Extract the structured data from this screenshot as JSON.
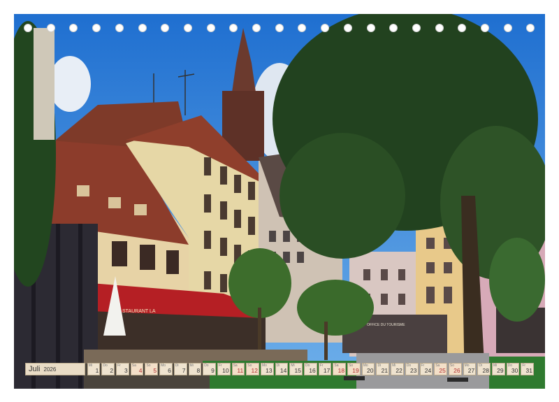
{
  "calendar": {
    "month": "Juli",
    "year": "2026",
    "days": [
      {
        "wd": "Mi",
        "n": "1",
        "we": false
      },
      {
        "wd": "Do",
        "n": "2",
        "we": false
      },
      {
        "wd": "Fr",
        "n": "3",
        "we": false
      },
      {
        "wd": "Sa",
        "n": "4",
        "we": true
      },
      {
        "wd": "So",
        "n": "5",
        "we": true
      },
      {
        "wd": "Mo",
        "n": "6",
        "we": false
      },
      {
        "wd": "Di",
        "n": "7",
        "we": false
      },
      {
        "wd": "Mi",
        "n": "8",
        "we": false
      },
      {
        "wd": "Do",
        "n": "9",
        "we": false
      },
      {
        "wd": "Fr",
        "n": "10",
        "we": false
      },
      {
        "wd": "Sa",
        "n": "11",
        "we": true
      },
      {
        "wd": "So",
        "n": "12",
        "we": true
      },
      {
        "wd": "Mo",
        "n": "13",
        "we": false
      },
      {
        "wd": "Di",
        "n": "14",
        "we": false
      },
      {
        "wd": "Mi",
        "n": "15",
        "we": false
      },
      {
        "wd": "Do",
        "n": "16",
        "we": false
      },
      {
        "wd": "Fr",
        "n": "17",
        "we": false
      },
      {
        "wd": "Sa",
        "n": "18",
        "we": true
      },
      {
        "wd": "So",
        "n": "19",
        "we": true
      },
      {
        "wd": "Mo",
        "n": "20",
        "we": false
      },
      {
        "wd": "Di",
        "n": "21",
        "we": false
      },
      {
        "wd": "Mi",
        "n": "22",
        "we": false
      },
      {
        "wd": "Do",
        "n": "23",
        "we": false
      },
      {
        "wd": "Fr",
        "n": "24",
        "we": false
      },
      {
        "wd": "Sa",
        "n": "25",
        "we": true
      },
      {
        "wd": "So",
        "n": "26",
        "we": true
      },
      {
        "wd": "Mo",
        "n": "27",
        "we": false
      },
      {
        "wd": "Di",
        "n": "28",
        "we": false
      },
      {
        "wd": "Mi",
        "n": "29",
        "we": false
      },
      {
        "wd": "Do",
        "n": "30",
        "we": false
      },
      {
        "wd": "Fr",
        "n": "31",
        "we": false
      }
    ]
  },
  "photo": {
    "shop_sign_left": "STAURANT LA",
    "shop_sign_right": "OFFICE DU TOURISME"
  },
  "colors": {
    "sky": "#2f7fd6",
    "awning": "#b51f24",
    "tree": "#1f3d1b",
    "roof": "#8a3b2a",
    "facade_cream": "#e8d5a8",
    "calendar_bg": "#efe3cf"
  }
}
